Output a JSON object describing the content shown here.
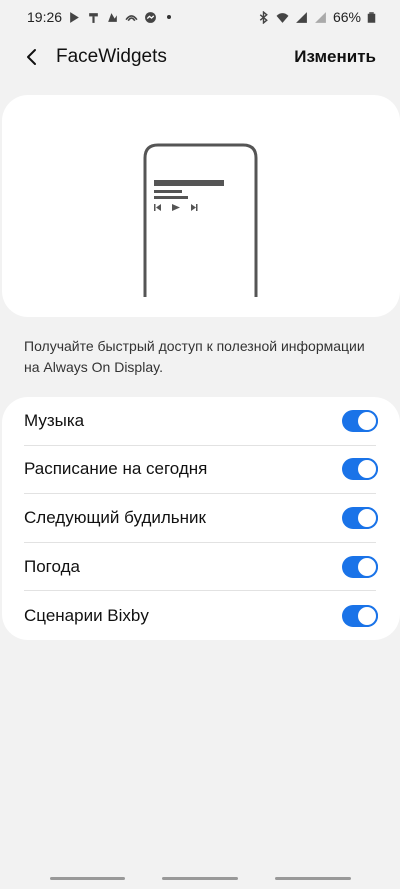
{
  "status_bar": {
    "time": "19:26",
    "battery": "66%"
  },
  "app_bar": {
    "title": "FaceWidgets",
    "edit_label": "Изменить"
  },
  "description": "Получайте быстрый доступ к полезной информации на Always On Display.",
  "settings": [
    {
      "label": "Музыка",
      "enabled": true
    },
    {
      "label": "Расписание на сегодня",
      "enabled": true
    },
    {
      "label": "Следующий будильник",
      "enabled": true
    },
    {
      "label": "Погода",
      "enabled": true
    },
    {
      "label": "Сценарии Bixby",
      "enabled": true
    }
  ],
  "colors": {
    "accent": "#1a73e8",
    "background": "#f2f2f2",
    "card": "#ffffff"
  }
}
